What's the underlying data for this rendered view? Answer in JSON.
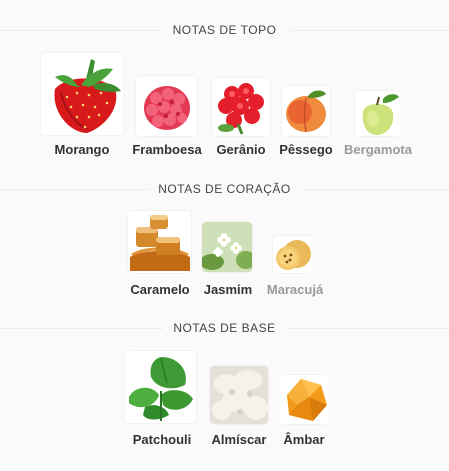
{
  "sections": [
    {
      "title": "NOTAS DE TOPO",
      "items": [
        {
          "label": "Morango",
          "icon": "strawberry-icon"
        },
        {
          "label": "Framboesa",
          "icon": "raspberry-icon"
        },
        {
          "label": "Gerânio",
          "icon": "geranium-icon"
        },
        {
          "label": "Pêssego",
          "icon": "peach-icon"
        },
        {
          "label": "Bergamota",
          "icon": "bergamot-icon"
        }
      ]
    },
    {
      "title": "NOTAS DE CORAÇÃO",
      "items": [
        {
          "label": "Caramelo",
          "icon": "caramel-icon"
        },
        {
          "label": "Jasmim",
          "icon": "jasmine-icon"
        },
        {
          "label": "Maracujá",
          "icon": "passion-fruit-icon"
        }
      ]
    },
    {
      "title": "NOTAS DE BASE",
      "items": [
        {
          "label": "Patchouli",
          "icon": "patchouli-icon"
        },
        {
          "label": "Almíscar",
          "icon": "musk-icon"
        },
        {
          "label": "Âmbar",
          "icon": "amber-icon"
        }
      ]
    }
  ]
}
